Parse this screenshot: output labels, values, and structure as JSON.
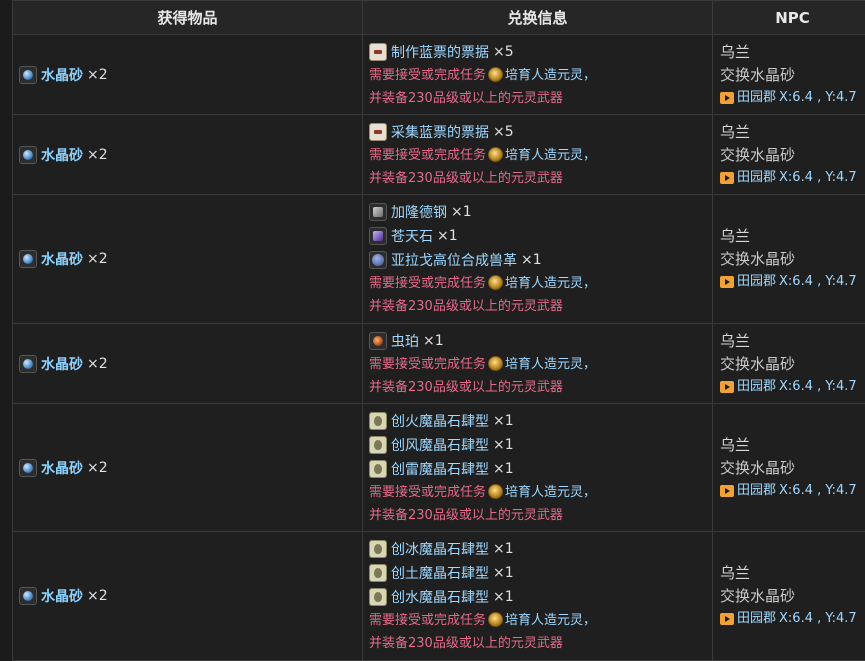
{
  "headers": {
    "item": "获得物品",
    "exchange": "兑换信息",
    "npc": "NPC"
  },
  "common": {
    "reward_name": "水晶砂",
    "reward_qty": "×2",
    "req_prefix": "需要接受或完成任务",
    "quest": "培育人造元灵，",
    "req_suffix": "并装备230品级或以上的元灵武器",
    "npc_name": "乌兰",
    "npc_action": "交换水晶砂",
    "location": "田园郡",
    "coords": "X:6.4 , Y:4.7"
  },
  "rows": [
    {
      "costs": [
        {
          "name": "制作蓝票的票据",
          "qty": "×5",
          "icon": "ticket"
        }
      ]
    },
    {
      "costs": [
        {
          "name": "采集蓝票的票据",
          "qty": "×5",
          "icon": "ticket"
        }
      ]
    },
    {
      "costs": [
        {
          "name": "加隆德钢",
          "qty": "×1",
          "icon": "metal"
        },
        {
          "name": "苍天石",
          "qty": "×1",
          "icon": "gem"
        },
        {
          "name": "亚拉戈高位合成兽革",
          "qty": "×1",
          "icon": "leather"
        }
      ]
    },
    {
      "costs": [
        {
          "name": "虫珀",
          "qty": "×1",
          "icon": "amber"
        }
      ]
    },
    {
      "costs": [
        {
          "name": "创火魔晶石肆型",
          "qty": "×1",
          "icon": "stone"
        },
        {
          "name": "创风魔晶石肆型",
          "qty": "×1",
          "icon": "stone"
        },
        {
          "name": "创雷魔晶石肆型",
          "qty": "×1",
          "icon": "stone"
        }
      ]
    },
    {
      "costs": [
        {
          "name": "创冰魔晶石肆型",
          "qty": "×1",
          "icon": "stone"
        },
        {
          "name": "创土魔晶石肆型",
          "qty": "×1",
          "icon": "stone"
        },
        {
          "name": "创水魔晶石肆型",
          "qty": "×1",
          "icon": "stone"
        }
      ]
    }
  ]
}
